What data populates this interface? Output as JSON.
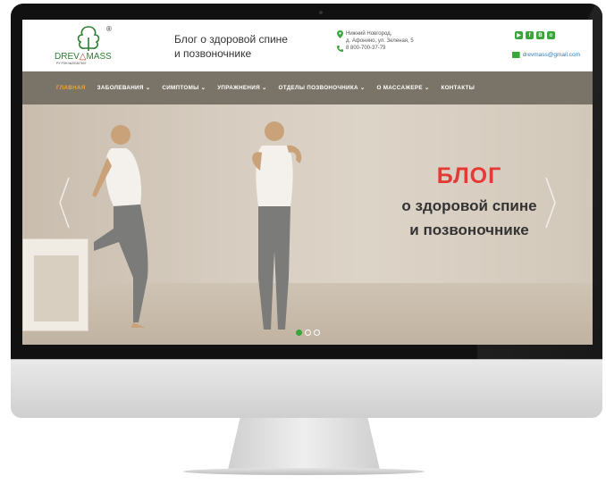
{
  "logo": {
    "brand_prefix": "DREV",
    "brand_mid": "△",
    "brand_suffix": "MASS",
    "reg_mark": "®",
    "reg_number": "РУ РЗН №2018/7607"
  },
  "header": {
    "tagline_line1": "Блог о здоровой спине",
    "tagline_line2": "и позвоночнике",
    "address_line1": "Нижний Новгород,",
    "address_line2": "д. Афонино, ул. Зеленая, 5",
    "phone": "8 800-700-37-79",
    "email": "drevmass@gmail.com",
    "social_icons": [
      "youtube-icon",
      "facebook-icon",
      "vk-icon",
      "ok-icon"
    ]
  },
  "nav": {
    "items": [
      {
        "label": "ГЛАВНАЯ",
        "active": true
      },
      {
        "label": "ЗАБОЛЕВАНИЯ ⌄"
      },
      {
        "label": "СИМПТОМЫ ⌄"
      },
      {
        "label": "УПРАЖНЕНИЯ ⌄"
      },
      {
        "label": "ОТДЕЛЫ ПОЗВОНОЧНИКА ⌄"
      },
      {
        "label": "О МАССАЖЕРЕ ⌄"
      },
      {
        "label": "КОНТАКТЫ"
      }
    ]
  },
  "hero": {
    "title": "БЛОГ",
    "subtitle_line1": "о здоровой спине",
    "subtitle_line2": "и позвоночнике",
    "slides": 3,
    "active_slide": 1
  },
  "colors": {
    "accent": "#3aa63a",
    "nav_bg": "#7a7368",
    "nav_active": "#f0a23a",
    "hero_title": "#e53935"
  }
}
